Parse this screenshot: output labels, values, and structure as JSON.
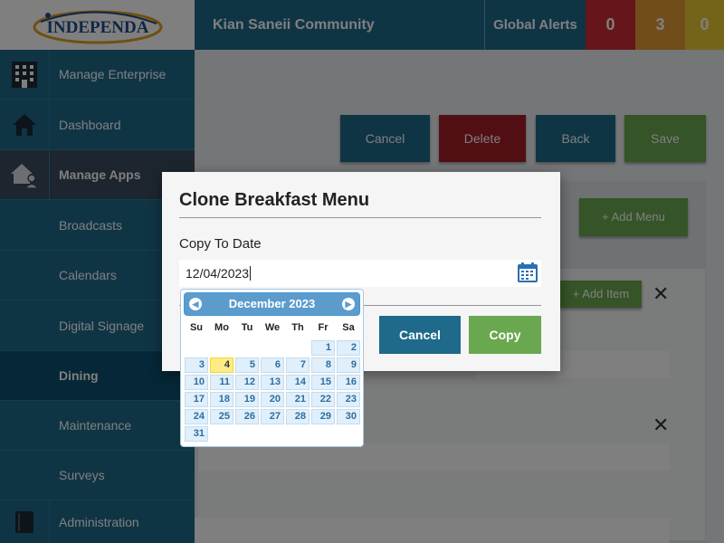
{
  "app": {
    "logo_text": "INDEPENDA"
  },
  "header": {
    "community": "Kian Saneii Community",
    "alerts_label": "Global Alerts",
    "alert_counts": [
      "0",
      "3",
      "0"
    ]
  },
  "sidebar": {
    "items": [
      {
        "label": "Manage Enterprise",
        "icon": "building-icon"
      },
      {
        "label": "Dashboard",
        "icon": "home-icon"
      },
      {
        "label": "Manage Apps",
        "icon": "house-person-icon"
      },
      {
        "label": "Broadcasts"
      },
      {
        "label": "Calendars"
      },
      {
        "label": "Digital Signage"
      },
      {
        "label": "Dining"
      },
      {
        "label": "Maintenance"
      },
      {
        "label": "Surveys"
      },
      {
        "label": "Administration",
        "icon": "book-icon"
      }
    ]
  },
  "toolbar": {
    "cancel_label": "Cancel",
    "delete_label": "Delete",
    "back_label": "Back",
    "save_label": "Save"
  },
  "main": {
    "add_menu_label": "+ Add Menu",
    "add_item_label": "+ Add Item"
  },
  "modal": {
    "title": "Clone Breakfast Menu",
    "field_label": "Copy To Date",
    "date_value": "12/04/2023",
    "cancel_label": "Cancel",
    "copy_label": "Copy"
  },
  "datepicker": {
    "month_year": "December 2023",
    "weekdays": [
      "Su",
      "Mo",
      "Tu",
      "We",
      "Th",
      "Fr",
      "Sa"
    ],
    "first_weekday_index": 5,
    "days_in_month": 31,
    "selected_day": 4
  },
  "colors": {
    "header_blue": "#1f6a8a",
    "alert_red": "#cc2a35",
    "alert_orange": "#e39b37",
    "alert_yellow": "#e6c933",
    "button_blue": "#1f6a8a",
    "button_red": "#a41e27",
    "button_green": "#6aa84f"
  }
}
